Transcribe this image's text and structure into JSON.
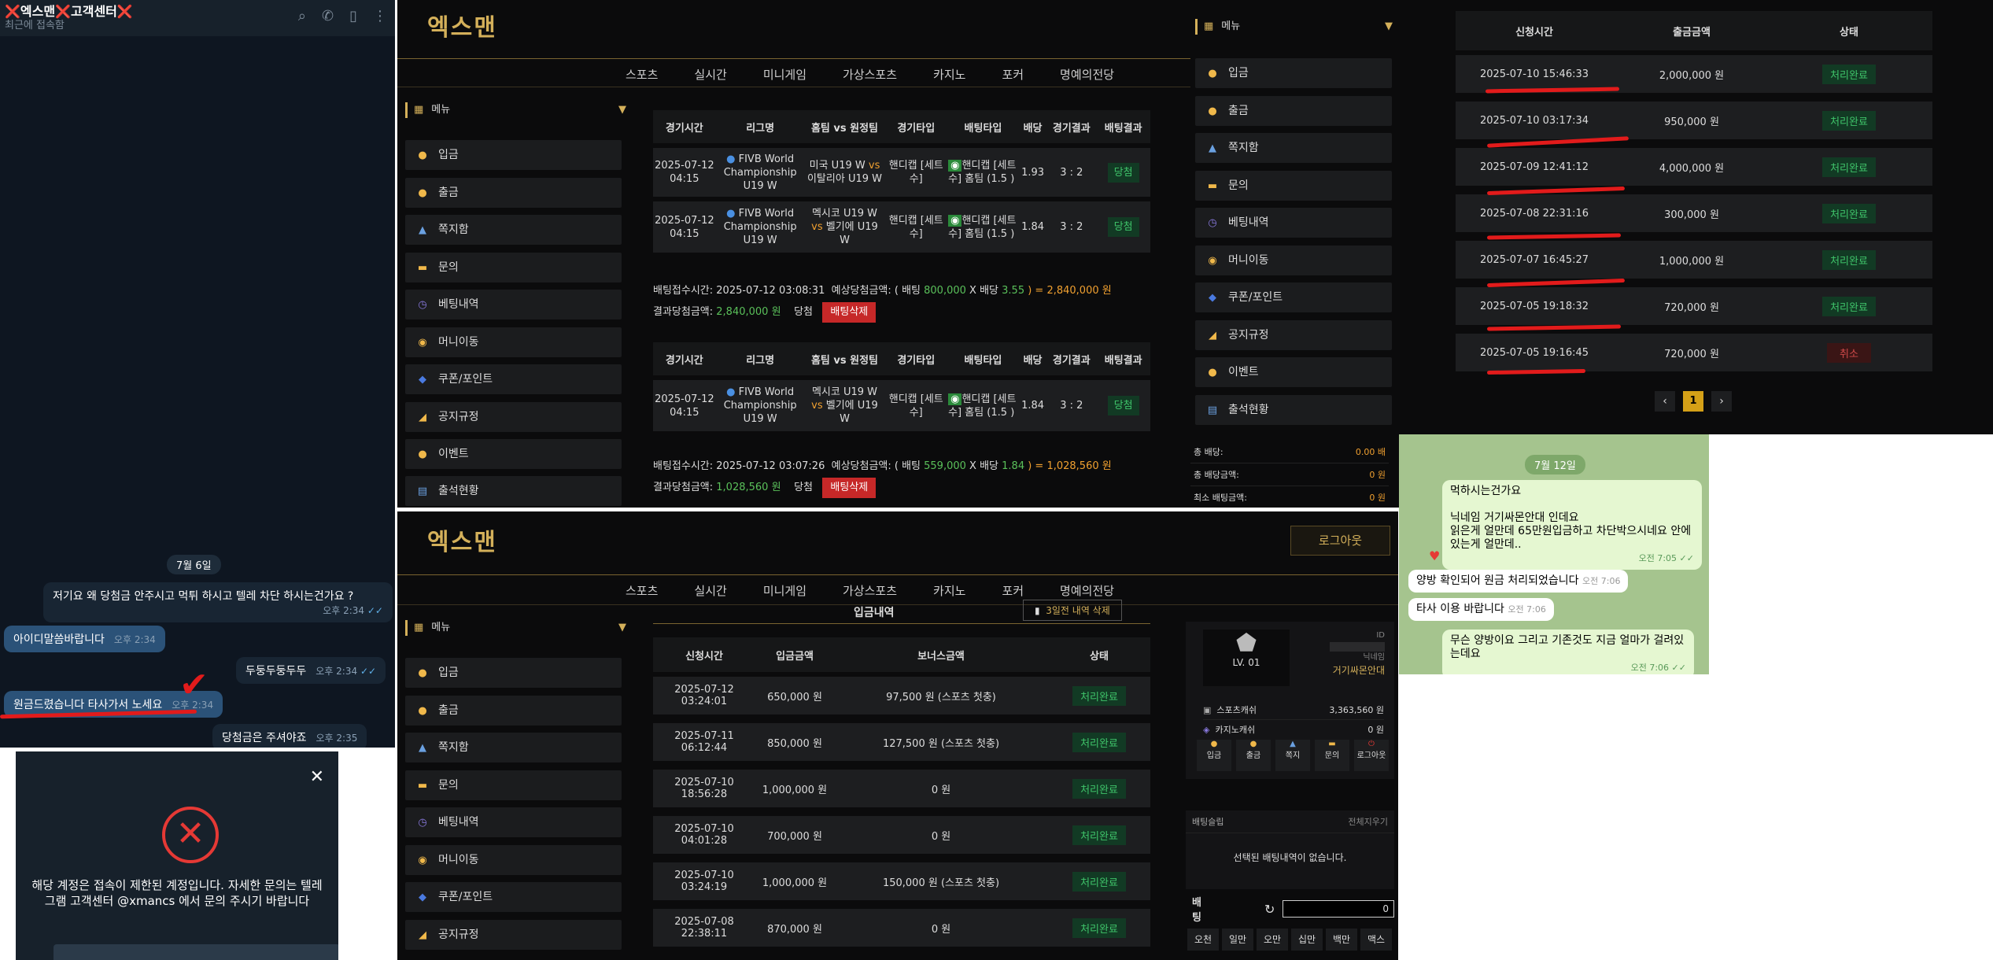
{
  "telegram": {
    "title": "❌엑스맨❌고객센터❌",
    "subtitle": "최근에 접속함",
    "date_chip": "7월 6일",
    "messages": [
      {
        "dir": "in",
        "text": "저기요 왜 당첨금 안주시고 먹튀 하시고 텔레 차단 하시는건가요 ?",
        "time": "오후 2:34"
      },
      {
        "dir": "out",
        "text": "아이디말씀바랍니다",
        "time": "오후 2:34"
      },
      {
        "dir": "in",
        "text": "두둥두둥두두",
        "time": "오후 2:34"
      },
      {
        "dir": "out",
        "text": "원금드렸습니다 타사가서 노세요",
        "time": "오후 2:34"
      },
      {
        "dir": "in",
        "text": "당첨금은 주셔야죠",
        "time": "오후 2:35"
      }
    ]
  },
  "modal": {
    "message": "해당 계정은 접속이 제한된 계정입니다. 자세한 문의는 텔레그램 고객센터 @xmancs 에서 문의 주시기 바랍니다"
  },
  "site": {
    "logo": "엑스맨",
    "nav": [
      "스포츠",
      "실시간",
      "미니게임",
      "가상스포츠",
      "카지노",
      "포커",
      "명예의전당"
    ],
    "menu_label": "메뉴",
    "menu_items": [
      "입금",
      "출금",
      "쪽지함",
      "문의",
      "베팅내역",
      "머니이동",
      "쿠폰/포인트",
      "공지규정",
      "이벤트",
      "출석현황"
    ],
    "bet_headers": [
      "경기시간",
      "리그명",
      "홈팀 vs 원정팀",
      "경기타입",
      "배팅타입",
      "배당",
      "경기결과",
      "배팅결과"
    ],
    "bet_slip1": [
      {
        "time": "2025-07-12 04:15",
        "league": "FIVB World Championship U19 W",
        "home": "미국 U19 W",
        "away": "이탈리아 U19 W",
        "type": "핸디캡 [세트수]",
        "bet": "핸디캡 [세트수] 홈팀 (1.5 )",
        "odds": "1.93",
        "score": "3 : 2",
        "result": "당첨"
      },
      {
        "time": "2025-07-12 04:15",
        "league": "FIVB World Championship U19 W",
        "home": "멕시코 U19 W",
        "away": "벨기에 U19 W",
        "type": "핸디캡 [세트수]",
        "bet": "핸디캡 [세트수] 홈팀 (1.5 )",
        "odds": "1.84",
        "score": "3 : 2",
        "result": "당첨"
      }
    ],
    "slip1_summary": {
      "received": "배팅접수시간: 2025-07-12 03:08:31",
      "expected_prefix": "예상당첨금액: ( 배팅 ",
      "bet": "800,000",
      "x": " X 배당 ",
      "odds": "3.55",
      "total": " ) = 2,840,000 원",
      "result_label": "결과당첨금액: ",
      "result": "2,840,000 원",
      "win": "당첨",
      "delete": "배팅삭제"
    },
    "bet_slip2": [
      {
        "time": "2025-07-12 04:15",
        "league": "FIVB World Championship U19 W",
        "home": "멕시코 U19 W",
        "away": "벨기에 U19 W",
        "type": "핸디캡 [세트수]",
        "bet": "핸디캡 [세트수] 홈팀 (1.5 )",
        "odds": "1.84",
        "score": "3 : 2",
        "result": "당첨"
      }
    ],
    "slip2_summary": {
      "received": "배팅접수시간: 2025-07-12 03:07:26",
      "expected_prefix": "예상당첨금액: ( 배팅 ",
      "bet": "559,000",
      "x": " X 배당 ",
      "odds": "1.84",
      "total": " ) = 1,028,560 원",
      "result_label": "결과당첨금액: ",
      "result": "1,028,560 원",
      "win": "당첨",
      "delete": "배팅삭제"
    }
  },
  "withdrawals": {
    "headers": [
      "신청시간",
      "출금금액",
      "상태"
    ],
    "rows": [
      {
        "time": "2025-07-10 15:46:33",
        "amount": "2,000,000 원",
        "status": "처리완료"
      },
      {
        "time": "2025-07-10 03:17:34",
        "amount": "950,000 원",
        "status": "처리완료"
      },
      {
        "time": "2025-07-09 12:41:12",
        "amount": "4,000,000 원",
        "status": "처리완료"
      },
      {
        "time": "2025-07-08 22:31:16",
        "amount": "300,000 원",
        "status": "처리완료"
      },
      {
        "time": "2025-07-07 16:45:27",
        "amount": "1,000,000 원",
        "status": "처리완료"
      },
      {
        "time": "2025-07-05 19:18:32",
        "amount": "720,000 원",
        "status": "처리완료"
      },
      {
        "time": "2025-07-05 19:16:45",
        "amount": "720,000 원",
        "status": "취소"
      }
    ],
    "page": "1"
  },
  "side_summary": {
    "total_bet": "총 배당:",
    "total_bet_val": "0.00 배",
    "total_win": "총 배당금액:",
    "total_win_val": "0 원",
    "min": "최소 배팅금액:",
    "min_val": "0 원"
  },
  "telegram2": {
    "date_chip": "7월 12일",
    "messages": [
      {
        "dir": "out",
        "text": "먹하시는건가요\n\n닉네임 거기싸몬안대 인데요\n읽은게 얼만데 65만원입금하고 차단박으시네요 안에 있는게 얼만데..",
        "time": "오전 7:05"
      },
      {
        "dir": "in",
        "text": "양방 확인되어 원금 처리되었습니다",
        "time": "오전 7:06"
      },
      {
        "dir": "in",
        "text": "타사 이용 바랍니다",
        "time": "오전 7:06"
      },
      {
        "dir": "out",
        "text": "무슨 양방이요 그리고 기존것도 지금 얼마가 걸려있는데요",
        "time": "오전 7:06"
      }
    ]
  },
  "deposits": {
    "title": "입금내역",
    "delete_btn": "3일전 내역 삭제",
    "headers": [
      "신청시간",
      "입금금액",
      "보너스금액",
      "상태"
    ],
    "rows": [
      {
        "time": "2025-07-12 03:24:01",
        "amount": "650,000 원",
        "bonus": "97,500 원 (스포츠 첫충)",
        "status": "처리완료"
      },
      {
        "time": "2025-07-11 06:12:44",
        "amount": "850,000 원",
        "bonus": "127,500 원 (스포츠 첫충)",
        "status": "처리완료"
      },
      {
        "time": "2025-07-10 18:56:28",
        "amount": "1,000,000 원",
        "bonus": "0 원",
        "status": "처리완료"
      },
      {
        "time": "2025-07-10 04:01:28",
        "amount": "700,000 원",
        "bonus": "0 원",
        "status": "처리완료"
      },
      {
        "time": "2025-07-10 03:24:19",
        "amount": "1,000,000 원",
        "bonus": "150,000 원 (스포츠 첫충)",
        "status": "처리완료"
      },
      {
        "time": "2025-07-08 22:38:11",
        "amount": "870,000 원",
        "bonus": "0 원",
        "status": "처리완료"
      }
    ]
  },
  "user": {
    "logout": "로그아웃",
    "level": "LV. 01",
    "id_label": "ID",
    "nick_label": "닉네임",
    "nick": "거기싸몬안대",
    "sports_money_label": "스포츠캐쉬",
    "sports_money": "3,363,560 원",
    "casino_money_label": "카지노캐쉬",
    "casino_money": "0 원",
    "quick": [
      "입금",
      "출금",
      "쪽지",
      "문의",
      "로그아웃"
    ],
    "cart_title": "배팅슬립",
    "cart_clear": "전체지우기",
    "cart_empty": "선택된 배팅내역이 없습니다.",
    "bet_label": "배팅",
    "bet_input": "0",
    "amount_btns": [
      "오천",
      "일만",
      "오만",
      "십만",
      "백만",
      "맥스"
    ]
  }
}
